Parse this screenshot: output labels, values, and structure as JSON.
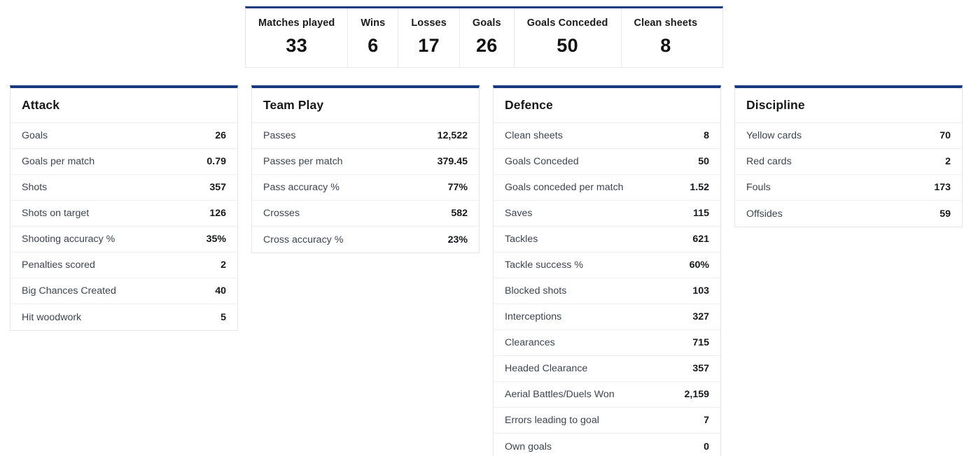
{
  "theme": {
    "accent_navy": "#17397f",
    "label_color": "#3d4450",
    "value_color": "#16181c",
    "border_color": "#e6e6e6"
  },
  "summary": {
    "items": [
      {
        "label": "Matches played",
        "value": "33"
      },
      {
        "label": "Wins",
        "value": "6"
      },
      {
        "label": "Losses",
        "value": "17"
      },
      {
        "label": "Goals",
        "value": "26"
      },
      {
        "label": "Goals Conceded",
        "value": "50"
      },
      {
        "label": "Clean sheets",
        "value": "8"
      }
    ]
  },
  "cards": [
    {
      "title": "Attack",
      "rows": [
        {
          "label": "Goals",
          "value": "26"
        },
        {
          "label": "Goals per match",
          "value": "0.79"
        },
        {
          "label": "Shots",
          "value": "357"
        },
        {
          "label": "Shots on target",
          "value": "126"
        },
        {
          "label": "Shooting accuracy %",
          "value": "35%"
        },
        {
          "label": "Penalties scored",
          "value": "2"
        },
        {
          "label": "Big Chances Created",
          "value": "40"
        },
        {
          "label": "Hit woodwork",
          "value": "5"
        }
      ]
    },
    {
      "title": "Team Play",
      "rows": [
        {
          "label": "Passes",
          "value": "12,522"
        },
        {
          "label": "Passes per match",
          "value": "379.45"
        },
        {
          "label": "Pass accuracy %",
          "value": "77%"
        },
        {
          "label": "Crosses",
          "value": "582"
        },
        {
          "label": "Cross accuracy %",
          "value": "23%"
        }
      ]
    },
    {
      "title": "Defence",
      "rows": [
        {
          "label": "Clean sheets",
          "value": "8"
        },
        {
          "label": "Goals Conceded",
          "value": "50"
        },
        {
          "label": "Goals conceded per match",
          "value": "1.52"
        },
        {
          "label": "Saves",
          "value": "115"
        },
        {
          "label": "Tackles",
          "value": "621"
        },
        {
          "label": "Tackle success %",
          "value": "60%"
        },
        {
          "label": "Blocked shots",
          "value": "103"
        },
        {
          "label": "Interceptions",
          "value": "327"
        },
        {
          "label": "Clearances",
          "value": "715"
        },
        {
          "label": "Headed Clearance",
          "value": "357"
        },
        {
          "label": "Aerial Battles/Duels Won",
          "value": "2,159"
        },
        {
          "label": "Errors leading to goal",
          "value": "7"
        },
        {
          "label": "Own goals",
          "value": "0"
        }
      ]
    },
    {
      "title": "Discipline",
      "rows": [
        {
          "label": "Yellow cards",
          "value": "70"
        },
        {
          "label": "Red cards",
          "value": "2"
        },
        {
          "label": "Fouls",
          "value": "173"
        },
        {
          "label": "Offsides",
          "value": "59"
        }
      ]
    }
  ]
}
